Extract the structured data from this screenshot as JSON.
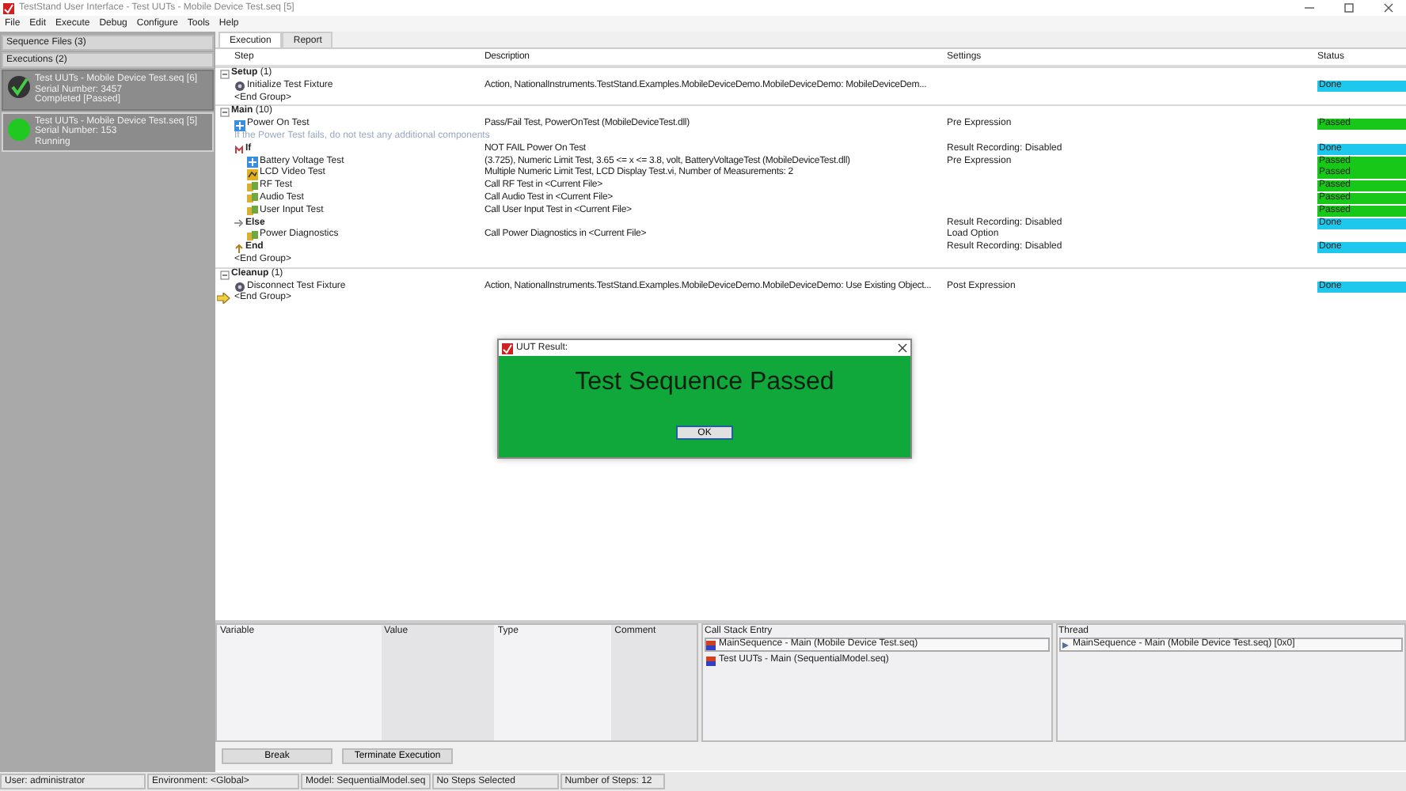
{
  "window": {
    "title": "TestStand User Interface - Test UUTs - Mobile Device Test.seq [5]"
  },
  "menu": [
    "File",
    "Edit",
    "Execute",
    "Debug",
    "Configure",
    "Tools",
    "Help"
  ],
  "sidebar": {
    "sections": [
      "Sequence Files (3)",
      "Executions (2)"
    ],
    "executions": [
      {
        "kind": "completed",
        "selected": false,
        "lines": [
          "Test UUTs - Mobile Device Test.seq [6]",
          "Serial Number: 3457",
          "Completed [Passed]"
        ]
      },
      {
        "kind": "running",
        "selected": true,
        "lines": [
          "Test UUTs - Mobile Device Test.seq [5]",
          "Serial Number: 153",
          "Running"
        ]
      }
    ]
  },
  "tabs": [
    {
      "label": "Execution",
      "selected": true
    },
    {
      "label": "Report",
      "selected": false
    }
  ],
  "grid": {
    "columns": [
      "Step",
      "Description",
      "Settings",
      "Status"
    ],
    "groups": [
      {
        "label": "**Setup** (1)",
        "expanded": true,
        "steps": [
          {
            "kind": "action",
            "name": "Initialize Test Fixture",
            "description": "Action,  NationalInstruments.TestStand.Examples.MobileDeviceDemo.MobileDeviceDemo: MobileDeviceDem...",
            "status": {
              "label": "Done",
              "color": "#1ec8ec"
            },
            "current": false
          },
          {
            "kind": "end-group",
            "name": "<End Group>",
            "current": false
          }
        ]
      },
      {
        "label": "**Main** (10)",
        "expanded": true,
        "steps": [
          {
            "kind": "pass-fail",
            "name": "Power On Test",
            "description": "Pass/Fail Test,  PowerOnTest (MobileDeviceTest.dll)",
            "settings": "Pre Expression",
            "status": {
              "label": "Passed",
              "color": "#18c818"
            },
            "current": false
          },
          {
            "kind": "comment",
            "name": "If the Power Test fails, do not test any additional components",
            "current": false
          },
          {
            "kind": "if",
            "name": "If",
            "description": "NOT FAIL Power On Test",
            "settings": "Result Recording: Disabled",
            "status": {
              "label": "Done",
              "color": "#1ec8ec"
            },
            "current": false,
            "children": [
              {
                "kind": "numeric",
                "name": "Battery Voltage Test",
                "description": "(3.725), Numeric Limit Test,  3.65 <= x <= 3.8, volt, BatteryVoltageTest (MobileDeviceTest.dll)",
                "settings": "Pre Expression",
                "status": {
                  "label": "Passed",
                  "color": "#18c818"
                },
                "current": false
              },
              {
                "kind": "multi-numeric",
                "name": "LCD Video Test",
                "description": "Multiple Numeric Limit Test,  LCD Display Test.vi, Number of Measurements: 2",
                "status": {
                  "label": "Passed",
                  "color": "#18c818"
                },
                "current": false
              },
              {
                "kind": "sequence-call",
                "name": "RF Test",
                "description": "Call RF Test in <Current File>",
                "status": {
                  "label": "Passed",
                  "color": "#18c818"
                },
                "current": false
              },
              {
                "kind": "sequence-call",
                "name": "Audio Test",
                "description": "Call Audio Test in <Current File>",
                "status": {
                  "label": "Passed",
                  "color": "#18c818"
                },
                "current": false
              },
              {
                "kind": "sequence-call",
                "name": "User Input Test",
                "description": "Call User Input Test in <Current File>",
                "status": {
                  "label": "Passed",
                  "color": "#18c818"
                },
                "current": false
              }
            ]
          },
          {
            "kind": "else",
            "name": "Else",
            "settings": "Result Recording: Disabled",
            "status": {
              "label": "Done",
              "color": "#1ec8ec"
            },
            "current": false,
            "children": [
              {
                "kind": "sequence-call",
                "name": "Power Diagnostics",
                "description": "Call Power Diagnostics in <Current File>",
                "settings": "Load Option",
                "current": false
              }
            ]
          },
          {
            "kind": "end",
            "name": "End",
            "settings": "Result Recording: Disabled",
            "status": {
              "label": "Done",
              "color": "#1ec8ec"
            },
            "current": false
          },
          {
            "kind": "end-group",
            "name": "<End Group>",
            "current": false
          }
        ]
      },
      {
        "label": "**Cleanup** (1)",
        "expanded": true,
        "steps": [
          {
            "kind": "action",
            "name": "Disconnect Test Fixture",
            "description": "Action,  NationalInstruments.TestStand.Examples.MobileDeviceDemo.MobileDeviceDemo: Use Existing Object...",
            "settings": "Post Expression",
            "status": {
              "label": "Done",
              "color": "#1ec8ec"
            },
            "current": false
          },
          {
            "kind": "end-group",
            "name": "<End Group>",
            "current": true
          }
        ]
      }
    ]
  },
  "variables": {
    "columns": [
      "Variable",
      "Value",
      "Type",
      "Comment"
    ]
  },
  "call_stack": {
    "title": "Call Stack Entry",
    "entries": [
      {
        "label": "MainSequence - Main (Mobile Device Test.seq)",
        "selected": true
      },
      {
        "label": "Test UUTs - Main (SequentialModel.seq)",
        "selected": false
      }
    ]
  },
  "threads": {
    "title": "Thread",
    "entries": [
      {
        "label": "MainSequence - Main (Mobile Device Test.seq) [0x0]",
        "selected": true
      }
    ]
  },
  "buttons": [
    "Break",
    "Terminate Execution"
  ],
  "status_bar": [
    "User: administrator",
    "Environment: <Global>",
    "Model: SequentialModel.seq",
    "No Steps Selected",
    "Number of Steps: 12"
  ],
  "dialog": {
    "title": "UUT Result:",
    "message": "Test Sequence Passed",
    "button": "OK"
  }
}
